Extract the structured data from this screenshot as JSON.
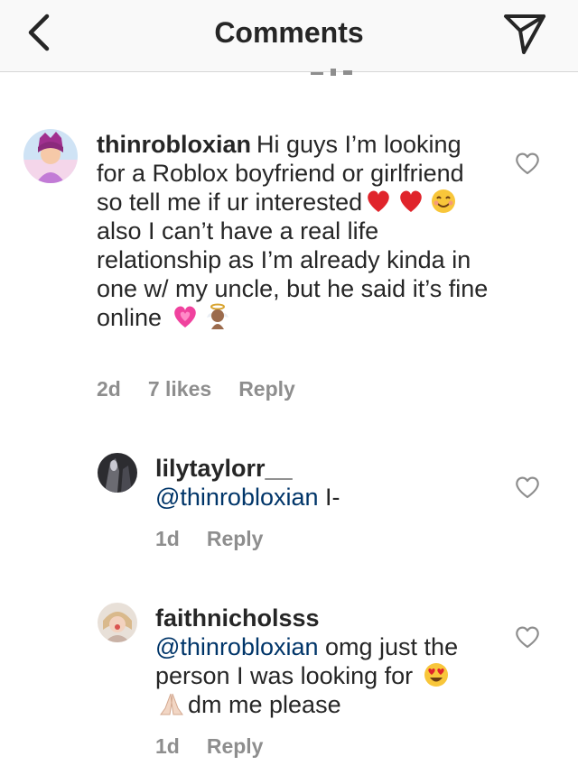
{
  "header": {
    "title": "Comments"
  },
  "comments": [
    {
      "username": "thinrobloxian",
      "text_1": "Hi guys I’m looking for a Roblox boyfriend or girlfriend so tell me if ur interested",
      "text_2": " also I can’t have a real life relationship as I’m already kinda in one w/ my uncle, but he said it’s fine online",
      "emojis_1": [
        "red-heart",
        "red-heart",
        "smiling-face"
      ],
      "emojis_2": [
        "growing-heart",
        "baby-angel"
      ],
      "time": "2d",
      "likes": "7 likes",
      "reply": "Reply"
    },
    {
      "username": "lilytaylorr__",
      "mention": "@thinrobloxian",
      "text": " I-",
      "time": "1d",
      "reply": "Reply"
    },
    {
      "username": "faithnicholsss",
      "mention": "@thinrobloxian",
      "text_1": " omg just the person I was looking for ",
      "text_2": "dm me please",
      "emojis_1": [
        "heart-eyes",
        "folded-hands"
      ],
      "time": "1d",
      "reply": "Reply"
    }
  ],
  "colors": {
    "text": "#262626",
    "secondary": "#8e8e8e",
    "mention": "#003569",
    "header_bg": "#f9f9f9"
  }
}
